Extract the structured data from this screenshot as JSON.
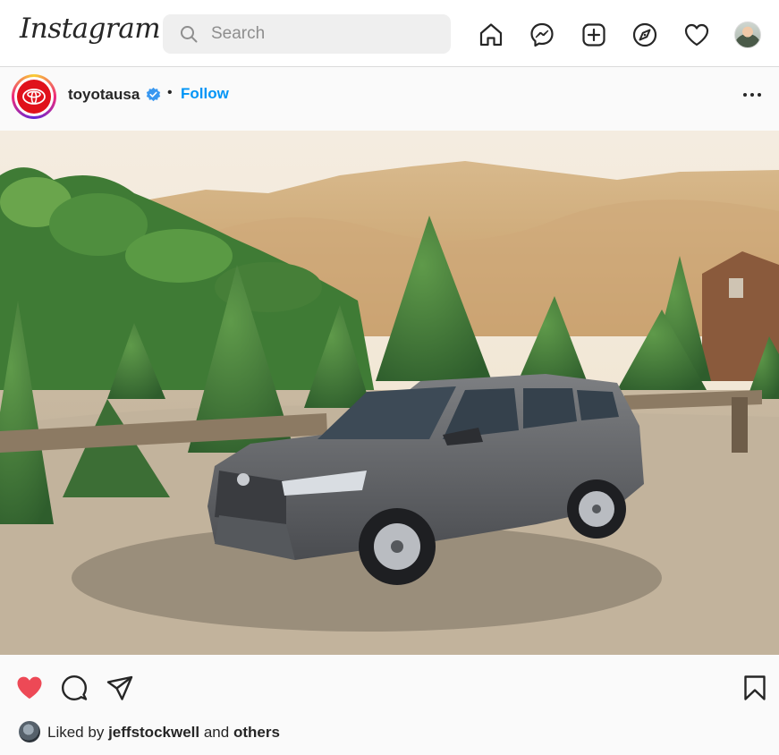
{
  "nav": {
    "logo": "Instagram",
    "search": {
      "placeholder": "Search"
    },
    "icons": [
      "home-icon",
      "messenger-icon",
      "new-post-icon",
      "explore-icon",
      "activity-heart-icon"
    ]
  },
  "post": {
    "username": "toyotausa",
    "verified": true,
    "separator": "•",
    "follow_label": "Follow",
    "liked_by_prefix": "Liked by",
    "liked_by_user": "jeffstockwell",
    "liked_by_and": "and",
    "liked_by_others": "others",
    "like_active": true,
    "colors": {
      "accent": "#0095f6",
      "like": "#ed4956",
      "brand": "#e0121b"
    }
  }
}
